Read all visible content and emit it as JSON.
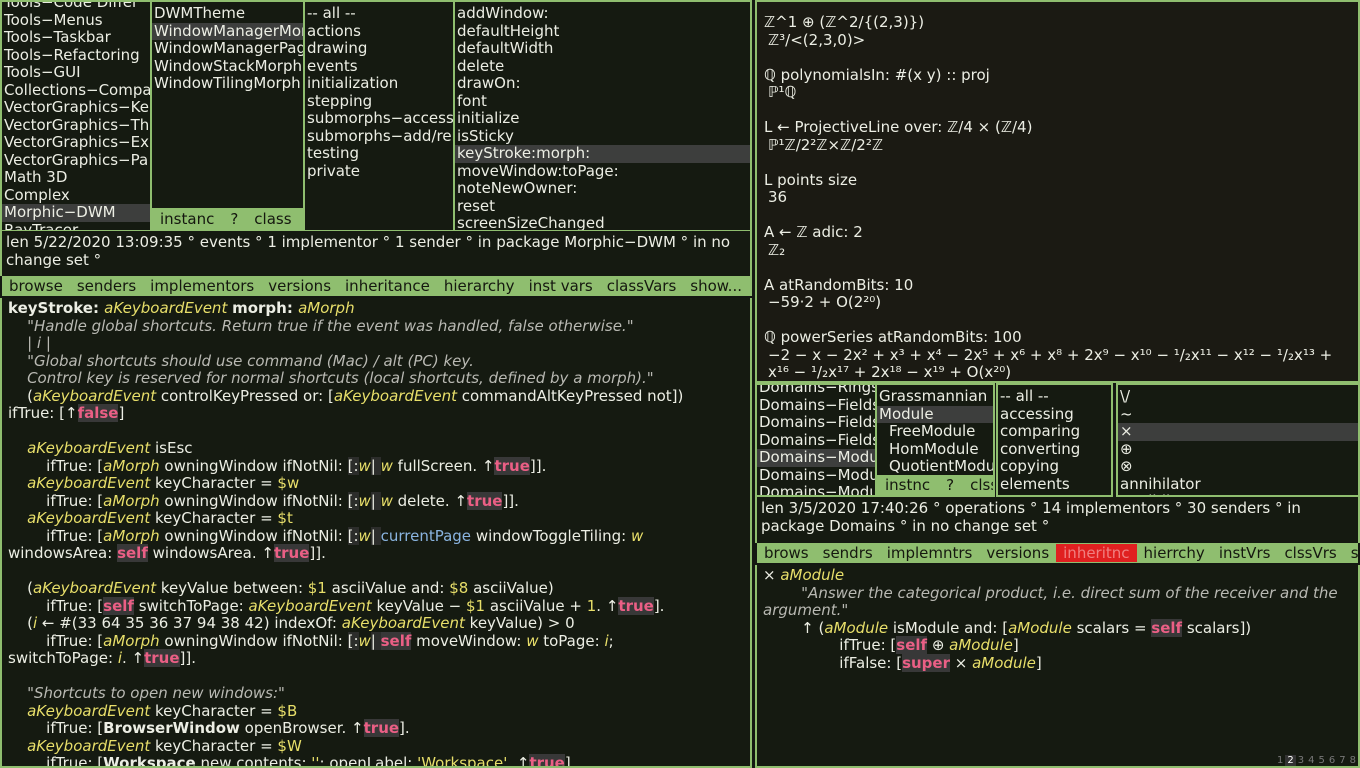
{
  "categories": [
    "Tools−Code Differ",
    "Tools−Menus",
    "Tools−Taskbar",
    "Tools−Refactoring",
    "Tools−GUI",
    "Collections−Compa",
    "VectorGraphics−Ke",
    "VectorGraphics−Th",
    "VectorGraphics−Ex",
    "VectorGraphics−Pa",
    "Math 3D",
    "Complex",
    "Morphic−DWM",
    "RayTracer"
  ],
  "categories_selected": 12,
  "classes": [
    "DWMTheme",
    "WindowManagerMorph",
    "WindowManagerPage",
    "WindowStackMorph",
    "WindowTilingMorph"
  ],
  "classes_selected": 1,
  "class_toggle": {
    "instance": "instanc",
    "help": "?",
    "class": "class"
  },
  "protocols": [
    "-- all --",
    "actions",
    "drawing",
    "events",
    "initialization",
    "stepping",
    "submorphs−accessing",
    "submorphs−add/remove",
    "testing",
    "private"
  ],
  "methods": [
    "addWindow:",
    "defaultHeight",
    "defaultWidth",
    "delete",
    "drawOn:",
    "font",
    "initialize",
    "isSticky",
    "keyStroke:morph:",
    "moveWindow:toPage:",
    "noteNewOwner:",
    "reset",
    "screenSizeChanged"
  ],
  "methods_selected": 8,
  "info_left": "len 5/22/2020 13:09:35 ° events ° 1 implementor ° 1 sender ° in package Morphic−DWM ° in no change set °",
  "buttons_left": [
    "browse",
    "senders",
    "implementors",
    "versions",
    "inheritance",
    "hierarchy",
    "inst vars",
    "classVars",
    "show..."
  ],
  "buttons_right": [
    "brows",
    "sendrs",
    "implemntrs",
    "versions",
    "inheritnc",
    "hierrchy",
    "instVrs",
    "clssVrs",
    "shw..."
  ],
  "buttons_right_highlight": 4,
  "code_left": {
    "l1_kw1": "keyStroke:",
    "l1_arg1": "aKeyboardEvent",
    "l1_kw2": "morph:",
    "l1_arg2": "aMorph",
    "l2": "\"Handle global shortcuts. Return true if the event was handled, false otherwise.\"",
    "l3": "| i |",
    "l4": "\"Global shortcuts should use command (Mac) / alt (PC) key.",
    "l5": "Control key is reserved for normal shortcuts (local shortcuts, defined by a morph).\"",
    "t_true": "true",
    "t_false": "false"
  },
  "rcat": [
    "Domains−Rings",
    "Domains−Fields",
    "Domains−Fields",
    "Domains−Fields",
    "Domains−Modules",
    "Domains−Modules",
    "Domains−Modules"
  ],
  "rcat_selected": 4,
  "rclasses": [
    "Grassmannian",
    "Module",
    "FreeModule",
    "HomModule",
    "QuotientModule"
  ],
  "rclasses_selected": 1,
  "rclass_toggle": {
    "instance": "instnc",
    "help": "?",
    "class": "clss"
  },
  "rprotocols": [
    "-- all --",
    "accessing",
    "comparing",
    "converting",
    "copying",
    "elements"
  ],
  "rmethods": [
    "\\/",
    "~",
    "×",
    "⊕",
    "⊗",
    "annihilator",
    "annihilatorSpace"
  ],
  "rmethods_selected": 2,
  "info_right": "len 3/5/2020 17:40:26 ° operations ° 14 implementors ° 30 senders ° in package Domains ° in no change set °",
  "code_right": {
    "l1_sel": "× ",
    "l1_arg": "aModule",
    "l2": "\"Answer the categorical product, i.e. direct sum of the receiver and the argument.\""
  },
  "workspace": {
    "e1": "ℤ^1 ⊕ (ℤ^2/{(2,3)})",
    "e3": "ℚ polynomialsIn: #(x y) :: proj",
    "e5": "L ← ProjectiveLine over: ℤ/4 × (ℤ/4)",
    "e7": "L points size",
    "r7": "36",
    "e8": "A ← ℤ adic: 2",
    "e10": "A atRandomBits: 10",
    "e11": "ℚ powerSeries atRandomBits: 100"
  },
  "pager": [
    "1",
    "2",
    "3",
    "4",
    "5",
    "6",
    "7",
    "8"
  ],
  "pager_current": 1,
  "colors": {
    "border": "#8fbe6f",
    "background": "#151a11",
    "selection": "#3d3e3d",
    "keyword_true": "#ea5f85",
    "argument": "#e8df6a",
    "highlight": "#e02020"
  }
}
